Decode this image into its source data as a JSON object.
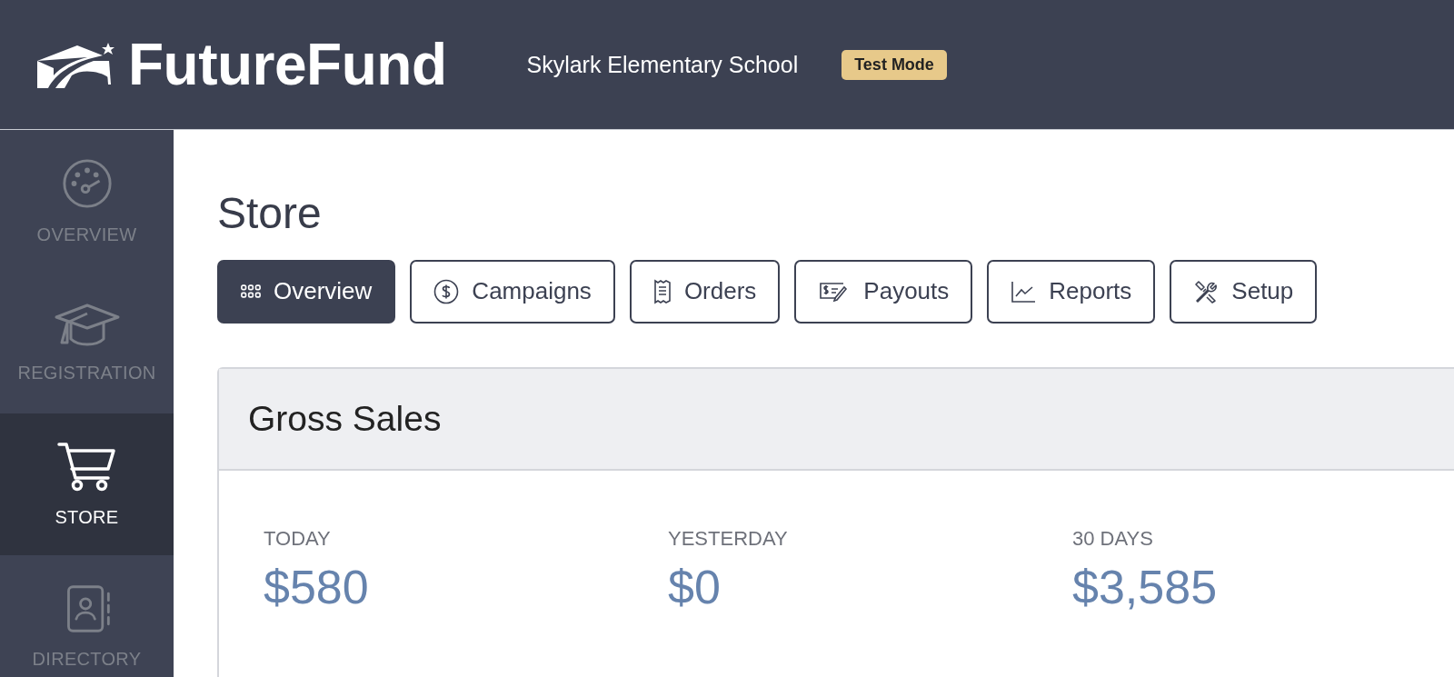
{
  "header": {
    "brand": "FutureFund",
    "school": "Skylark Elementary School",
    "badge": "Test Mode"
  },
  "sidebar": {
    "items": [
      {
        "label": "OVERVIEW",
        "selected": false
      },
      {
        "label": "REGISTRATION",
        "selected": false
      },
      {
        "label": "STORE",
        "selected": true
      },
      {
        "label": "DIRECTORY",
        "selected": false
      }
    ]
  },
  "page": {
    "title": "Store"
  },
  "tabs": [
    {
      "label": "Overview",
      "selected": true
    },
    {
      "label": "Campaigns",
      "selected": false
    },
    {
      "label": "Orders",
      "selected": false
    },
    {
      "label": "Payouts",
      "selected": false
    },
    {
      "label": "Reports",
      "selected": false
    },
    {
      "label": "Setup",
      "selected": false
    }
  ],
  "gross_sales": {
    "title": "Gross Sales",
    "stats": [
      {
        "label": "TODAY",
        "value": "$580"
      },
      {
        "label": "YESTERDAY",
        "value": "$0"
      },
      {
        "label": "30 DAYS",
        "value": "$3,585"
      }
    ]
  }
}
